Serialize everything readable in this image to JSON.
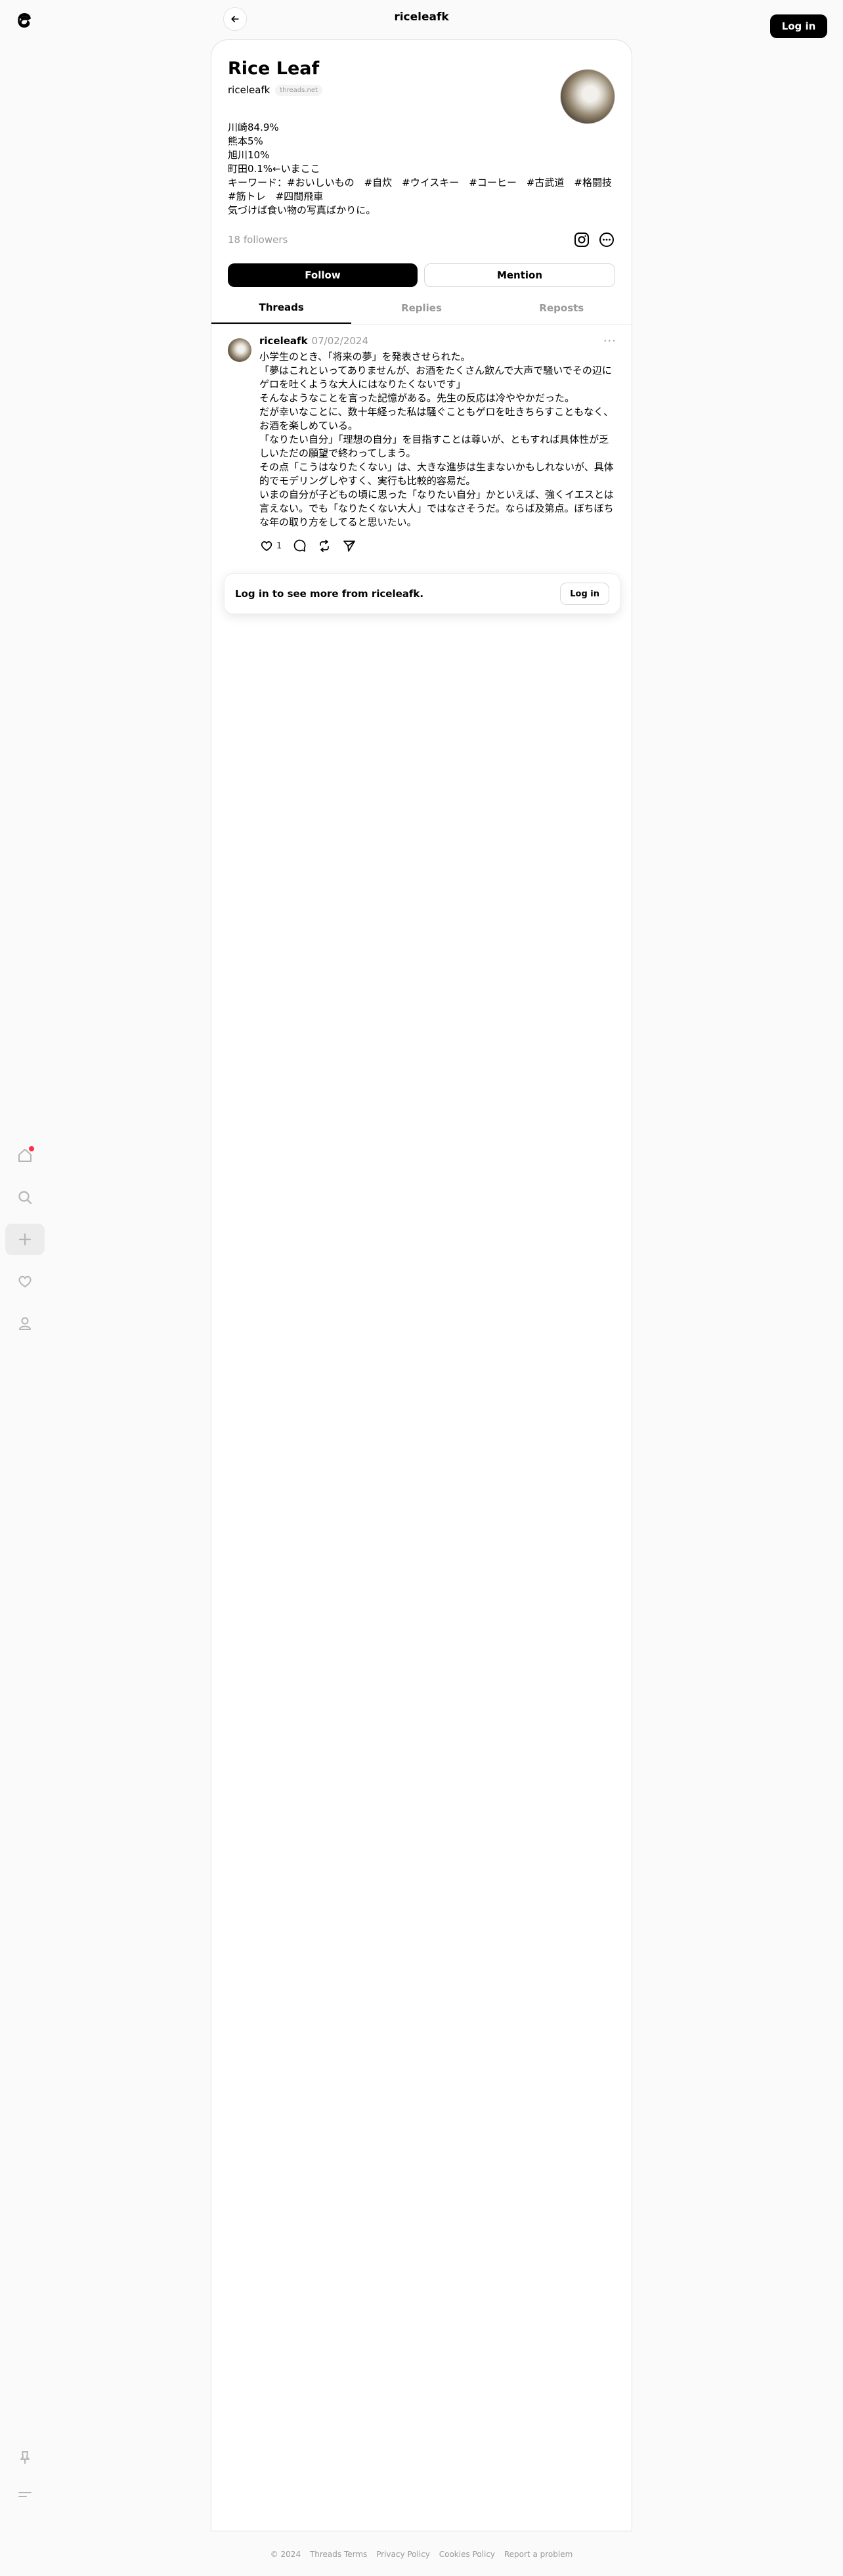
{
  "header": {
    "title": "riceleafk",
    "login_label": "Log in"
  },
  "profile": {
    "name": "Rice Leaf",
    "handle": "riceleafk",
    "domain_badge": "threads.net",
    "bio_lines": [
      "川崎84.9%",
      "熊本5%",
      "旭川10%",
      "町田0.1%←いまここ",
      "キーワード：#おいしいもの　#自炊　#ウイスキー　#コーヒー　#古武道　#格闘技",
      "#筋トレ　#四間飛車",
      "気づけば食い物の写真ばかりに。"
    ],
    "followers": "18 followers",
    "follow_label": "Follow",
    "mention_label": "Mention"
  },
  "tabs": [
    "Threads",
    "Replies",
    "Reposts"
  ],
  "post": {
    "user": "riceleafk",
    "date": "07/02/2024",
    "text_lines": [
      "小学生のとき、「将来の夢」を発表させられた。",
      "「夢はこれといってありませんが、お酒をたくさん飲んで大声で騒いでその辺に",
      "ゲロを吐くような大人にはなりたくないです」",
      "そんなようなことを言った記憶がある。先生の反応は冷ややかだった。",
      "だが幸いなことに、数十年経った私は騒ぐこともゲロを吐きちらすこともなく、",
      "お酒を楽しめている。",
      "「なりたい自分」「理想の自分」を目指すことは尊いが、ともすれば具体性が乏",
      "しいただの願望で終わってしまう。",
      "その点「こうはなりたくない」は、大きな進歩は生まないかもしれないが、具体",
      "的でモデリングしやすく、実行も比較的容易だ。",
      "いまの自分が子どもの頃に思った「なりたい自分」かといえば、強くイエスとは",
      "言えない。でも「なりたくない大人」ではなさそうだ。ならば及第点。ぼちぼち",
      "な年の取り方をしてると思いたい。"
    ],
    "like_count": "1"
  },
  "login_card": {
    "text": "Log in to see more from riceleafk.",
    "button_label": "Log in"
  },
  "footer": [
    "© 2024",
    "Threads Terms",
    "Privacy Policy",
    "Cookies Policy",
    "Report a problem"
  ],
  "colors": {
    "accent": "#000000",
    "muted": "#999999",
    "notification": "#ff3040"
  }
}
